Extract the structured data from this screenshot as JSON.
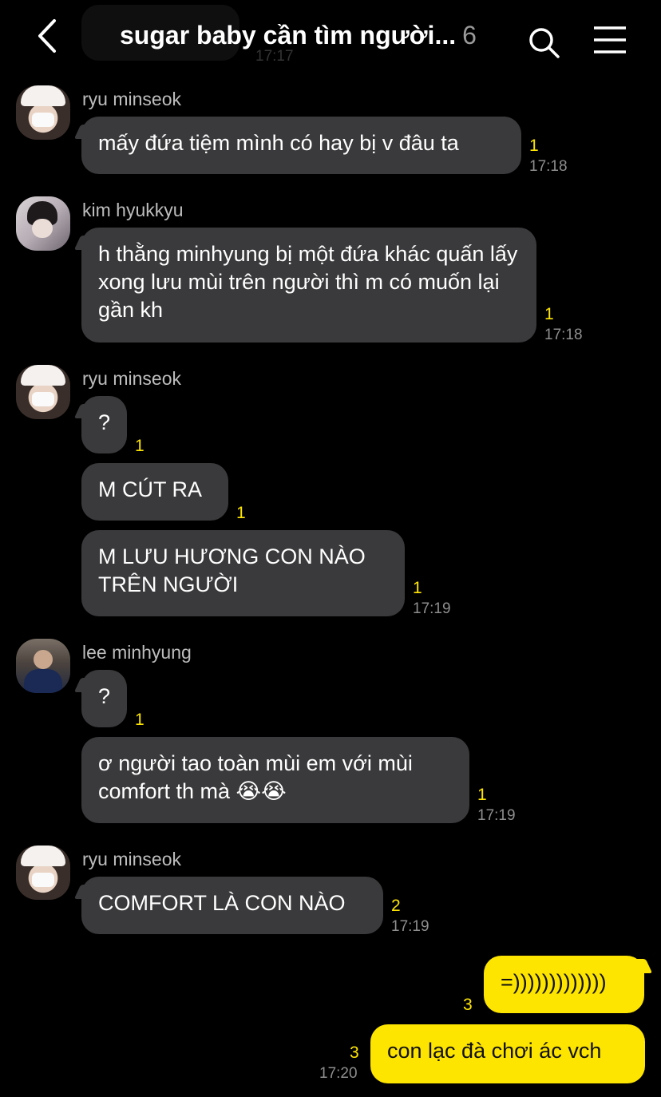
{
  "header": {
    "back_icon": "chevron-left-icon",
    "title": "sugar baby cần tìm người...",
    "member_count": "6",
    "search_icon": "search-icon",
    "menu_icon": "hamburger-menu-icon",
    "ghost_time": "17:17"
  },
  "colors": {
    "background": "#000000",
    "incoming_bubble": "#3a3a3c",
    "outgoing_bubble": "#fee500",
    "unread": "#fee500"
  },
  "messages": [
    {
      "sender": "ryu minseok",
      "avatar": "ryu-minseok",
      "bubbles": [
        {
          "text": "mấy đứa tiệm mình có hay bị v đâu ta",
          "unread": "1",
          "time": "17:18"
        }
      ]
    },
    {
      "sender": "kim hyukkyu",
      "avatar": "kim-hyukkyu",
      "bubbles": [
        {
          "text": "h thằng minhyung bị một đứa khác quấn lấy xong lưu mùi trên người thì m có muốn lại gần kh",
          "unread": "1",
          "time": "17:18"
        }
      ]
    },
    {
      "sender": "ryu minseok",
      "avatar": "ryu-minseok",
      "bubbles": [
        {
          "text": "?",
          "unread": "1",
          "time": ""
        },
        {
          "text": "M CÚT RA",
          "unread": "1",
          "time": ""
        },
        {
          "text": "M LƯU HƯƠNG CON NÀO TRÊN NGƯỜI",
          "unread": "1",
          "time": "17:19"
        }
      ]
    },
    {
      "sender": "lee minhyung",
      "avatar": "lee-minhyung",
      "bubbles": [
        {
          "text": "?",
          "unread": "1",
          "time": ""
        },
        {
          "text": "ơ người tao toàn mùi em với mùi comfort th mà 😭😭",
          "unread": "1",
          "time": "17:19"
        }
      ]
    },
    {
      "sender": "ryu minseok",
      "avatar": "ryu-minseok",
      "bubbles": [
        {
          "text": "COMFORT LÀ CON NÀO",
          "unread": "2",
          "time": "17:19"
        }
      ]
    },
    {
      "sender": "me",
      "outgoing": true,
      "bubbles": [
        {
          "text": "=)))))))))))))",
          "unread": "3",
          "time": ""
        },
        {
          "text": "con lạc đà chơi ác vch",
          "unread": "3",
          "time": "17:20"
        }
      ]
    }
  ]
}
